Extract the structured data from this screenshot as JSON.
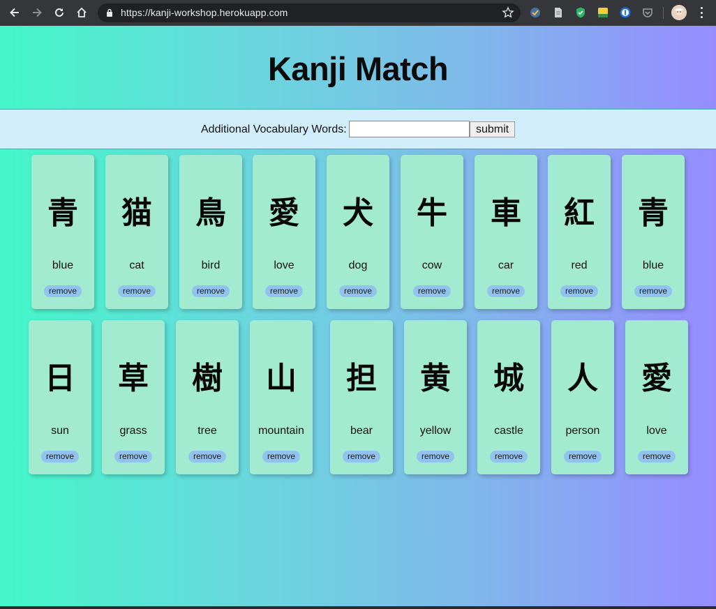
{
  "browser": {
    "url": "https://kanji-workshop.herokuapp.com"
  },
  "page": {
    "title": "Kanji Match",
    "vocab_label": "Additional Vocabulary Words:",
    "vocab_input_value": "",
    "submit_label": "submit",
    "remove_label": "remove"
  },
  "cards_row1": [
    {
      "kanji": "青",
      "meaning": "blue"
    },
    {
      "kanji": "猫",
      "meaning": "cat"
    },
    {
      "kanji": "鳥",
      "meaning": "bird"
    },
    {
      "kanji": "愛",
      "meaning": "love"
    },
    {
      "kanji": "犬",
      "meaning": "dog"
    },
    {
      "kanji": "牛",
      "meaning": "cow"
    },
    {
      "kanji": "車",
      "meaning": "car"
    },
    {
      "kanji": "紅",
      "meaning": "red"
    },
    {
      "kanji": "青",
      "meaning": "blue"
    }
  ],
  "cards_row2": [
    {
      "kanji": "日",
      "meaning": "sun"
    },
    {
      "kanji": "草",
      "meaning": "grass"
    },
    {
      "kanji": "樹",
      "meaning": "tree"
    },
    {
      "kanji": "山",
      "meaning": "mountain"
    },
    {
      "kanji": "担",
      "meaning": "bear"
    },
    {
      "kanji": "黄",
      "meaning": "yellow"
    },
    {
      "kanji": "城",
      "meaning": "castle"
    },
    {
      "kanji": "人",
      "meaning": "person"
    },
    {
      "kanji": "愛",
      "meaning": "love"
    }
  ],
  "colors": {
    "card": "#a2ead0",
    "remove_pill": "#92c3ef",
    "vocab_bar": "#d2eefd",
    "gradient_start": "#43f7c9",
    "gradient_end": "#968cff"
  }
}
